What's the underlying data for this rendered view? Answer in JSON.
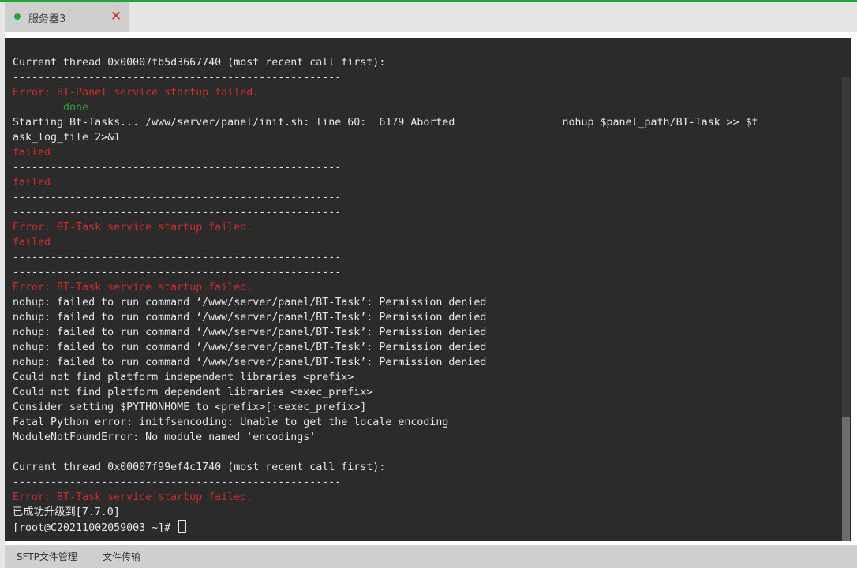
{
  "tab": {
    "title": "服务器3",
    "close_glyph": "✕",
    "status_color": "#20a53a"
  },
  "terminal": {
    "lines": [
      {
        "text": "Current thread 0x00007fb5d3667740 (most recent call first):",
        "cls": ""
      },
      {
        "text": "----------------------------------------------------",
        "cls": ""
      },
      {
        "text": "Error: BT-Panel service startup failed.",
        "cls": "red"
      },
      {
        "text": "        done",
        "cls": "green"
      },
      {
        "text": "Starting Bt-Tasks... /www/server/panel/init.sh: line 60:  6179 Aborted                 nohup $panel_path/BT-Task >> $t",
        "cls": ""
      },
      {
        "text": "ask_log_file 2>&1",
        "cls": ""
      },
      {
        "text": "failed",
        "cls": "red"
      },
      {
        "text": "----------------------------------------------------",
        "cls": ""
      },
      {
        "text": "failed",
        "cls": "red"
      },
      {
        "text": "----------------------------------------------------",
        "cls": ""
      },
      {
        "text": "----------------------------------------------------",
        "cls": ""
      },
      {
        "text": "Error: BT-Task service startup failed.",
        "cls": "red"
      },
      {
        "text": "failed",
        "cls": "red"
      },
      {
        "text": "----------------------------------------------------",
        "cls": ""
      },
      {
        "text": "----------------------------------------------------",
        "cls": ""
      },
      {
        "text": "Error: BT-Task service startup failed.",
        "cls": "red"
      },
      {
        "text": "nohup: failed to run command ‘/www/server/panel/BT-Task’: Permission denied",
        "cls": ""
      },
      {
        "text": "nohup: failed to run command ‘/www/server/panel/BT-Task’: Permission denied",
        "cls": ""
      },
      {
        "text": "nohup: failed to run command ‘/www/server/panel/BT-Task’: Permission denied",
        "cls": ""
      },
      {
        "text": "nohup: failed to run command ‘/www/server/panel/BT-Task’: Permission denied",
        "cls": ""
      },
      {
        "text": "nohup: failed to run command ‘/www/server/panel/BT-Task’: Permission denied",
        "cls": ""
      },
      {
        "text": "Could not find platform independent libraries <prefix>",
        "cls": ""
      },
      {
        "text": "Could not find platform dependent libraries <exec_prefix>",
        "cls": ""
      },
      {
        "text": "Consider setting $PYTHONHOME to <prefix>[:<exec_prefix>]",
        "cls": ""
      },
      {
        "text": "Fatal Python error: initfsencoding: Unable to get the locale encoding",
        "cls": ""
      },
      {
        "text": "ModuleNotFoundError: No module named 'encodings'",
        "cls": ""
      },
      {
        "text": "",
        "cls": ""
      },
      {
        "text": "Current thread 0x00007f99ef4c1740 (most recent call first):",
        "cls": ""
      },
      {
        "text": "----------------------------------------------------",
        "cls": ""
      },
      {
        "text": "Error: BT-Task service startup failed.",
        "cls": "red"
      },
      {
        "text": "已成功升级到[7.7.0]",
        "cls": ""
      }
    ],
    "prompt": "[root@C20211002059003 ~]# "
  },
  "footer": {
    "sftp_label": "SFTP文件管理",
    "transfer_label": "文件传输"
  }
}
